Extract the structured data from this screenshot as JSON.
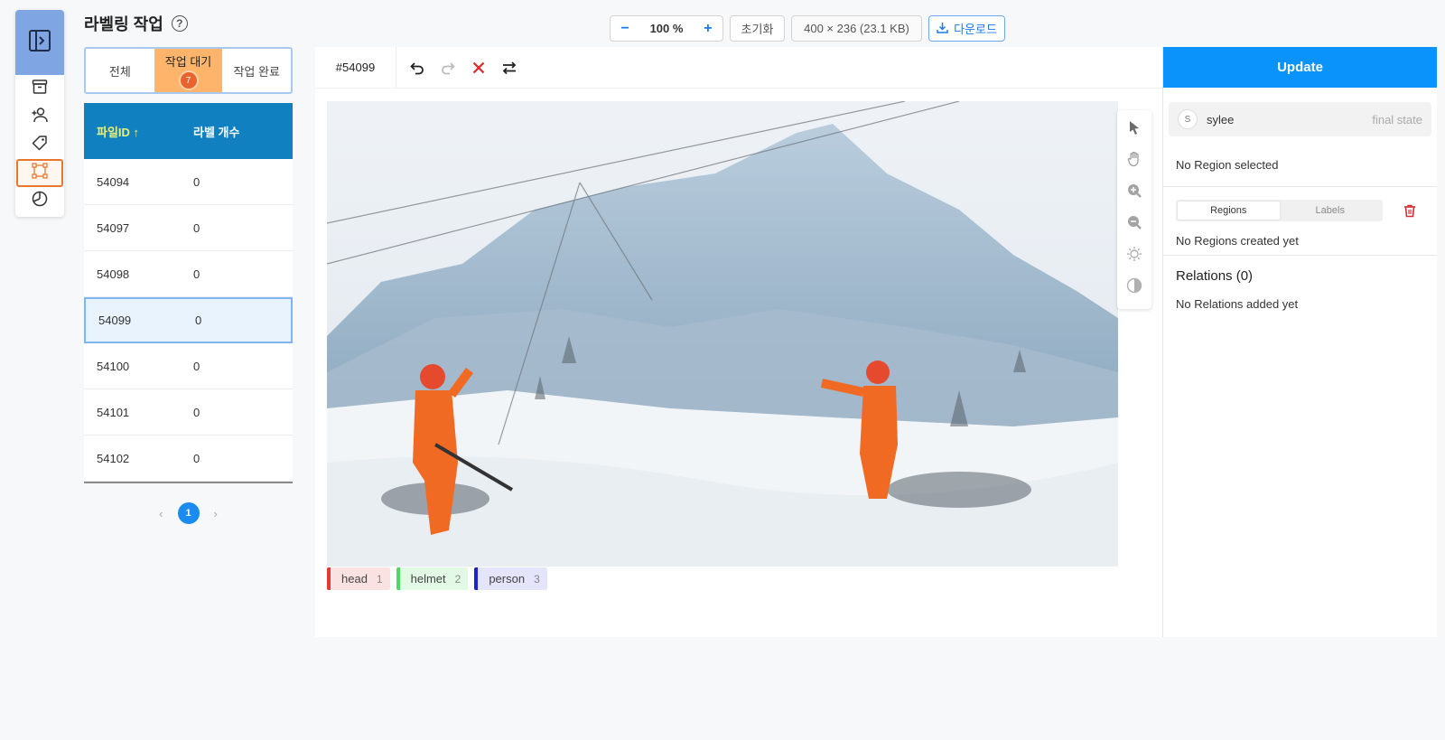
{
  "header": {
    "title": "라벨링 작업",
    "help": "?"
  },
  "toolbar": {
    "zoom_minus": "−",
    "zoom_value": "100 %",
    "zoom_plus": "+",
    "reset_label": "초기화",
    "image_info": "400 × 236 (23.1 KB)",
    "download_label": "다운로드"
  },
  "filter": {
    "tabs": [
      {
        "label": "전체"
      },
      {
        "label": "작업 대기",
        "count": "7",
        "active": true
      },
      {
        "label": "작업 완료"
      }
    ]
  },
  "file_table": {
    "columns": [
      "파일ID ↑",
      "라벨 개수"
    ],
    "rows": [
      {
        "id": "54094",
        "count": "0"
      },
      {
        "id": "54097",
        "count": "0"
      },
      {
        "id": "54098",
        "count": "0"
      },
      {
        "id": "54099",
        "count": "0",
        "selected": true
      },
      {
        "id": "54100",
        "count": "0"
      },
      {
        "id": "54101",
        "count": "0"
      },
      {
        "id": "54102",
        "count": "0"
      }
    ]
  },
  "pagination": {
    "prev": "‹",
    "current": "1",
    "next": "›"
  },
  "workspace": {
    "task_id": "#54099",
    "labels": [
      {
        "name": "head",
        "hotkey": "1",
        "color": "#e53935",
        "bg": "#fbe2e2"
      },
      {
        "name": "helmet",
        "hotkey": "2",
        "color": "#4cd964",
        "bg": "#e2f9e6"
      },
      {
        "name": "person",
        "hotkey": "3",
        "color": "#1a22d8",
        "bg": "#e4e5fb"
      }
    ]
  },
  "side_panel": {
    "update_label": "Update",
    "user_initial": "S",
    "user_name": "sylee",
    "user_state": "final state",
    "no_region": "No Region selected",
    "tabs": [
      "Regions",
      "Labels"
    ],
    "no_regions": "No Regions created yet",
    "relations_title": "Relations (0)",
    "no_relations": "No Relations added yet"
  },
  "colors": {
    "accent": "#0a93fa",
    "nav_active": "#e8772e",
    "table_header": "#1180c0",
    "filter_active": "#ffb46b"
  }
}
